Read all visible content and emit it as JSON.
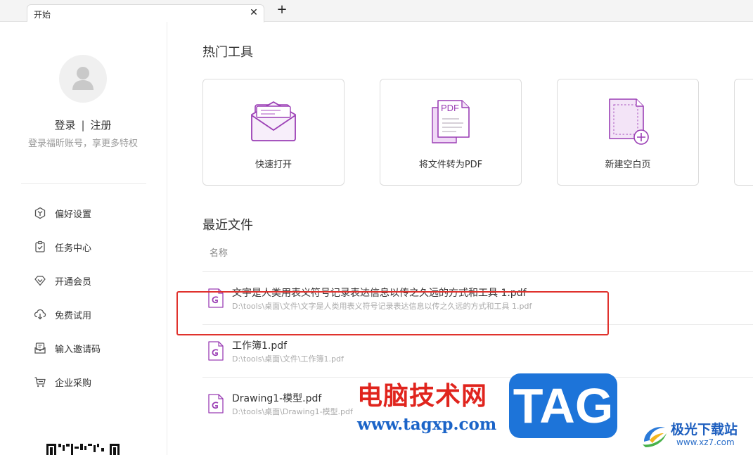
{
  "tabs": [
    {
      "title": "开始"
    }
  ],
  "tabbar": {
    "close_glyph": "✕",
    "add_glyph": "+"
  },
  "sidebar": {
    "login": "登录",
    "separator": "|",
    "register": "注册",
    "subtitle": "登录福昕账号，享更多特权",
    "menu": [
      {
        "label": "偏好设置",
        "icon": "preferences-icon"
      },
      {
        "label": "任务中心",
        "icon": "task-center-icon"
      },
      {
        "label": "开通会员",
        "icon": "membership-icon"
      },
      {
        "label": "免费试用",
        "icon": "free-trial-icon"
      },
      {
        "label": "输入邀请码",
        "icon": "invite-code-icon"
      },
      {
        "label": "企业采购",
        "icon": "enterprise-purchase-icon"
      }
    ]
  },
  "main": {
    "hot_tools_title": "热门工具",
    "tools": [
      {
        "label": "快速打开",
        "icon": "quick-open-icon"
      },
      {
        "label": "将文件转为PDF",
        "icon": "convert-to-pdf-icon",
        "icon_text": "PDF"
      },
      {
        "label": "新建空白页",
        "icon": "new-blank-page-icon"
      }
    ],
    "recent_title": "最近文件",
    "column_name": "名称",
    "files": [
      {
        "name": "文字是人类用表义符号记录表达信息以传之久远的方式和工具 1.pdf",
        "path": "D:\\tools\\桌面\\文件\\文字是人类用表义符号记录表达信息以传之久远的方式和工具 1.pdf"
      },
      {
        "name": "工作簿1.pdf",
        "path": "D:\\tools\\桌面\\文件\\工作簿1.pdf"
      },
      {
        "name": "Drawing1-模型.pdf",
        "path": "D:\\tools\\桌面\\Drawing1-模型.pdf"
      }
    ]
  },
  "watermark": {
    "cn_text": "电脑技术网",
    "url": "www.tagxp.com",
    "tag": "TAG",
    "site_name": "极光下载站",
    "site_url": "www.xz7.com"
  },
  "colors": {
    "accent_purple": "#9b3fb5",
    "highlight_red": "#e0322d",
    "watermark_red": "#e0241d",
    "watermark_blue": "#1d74d9"
  }
}
